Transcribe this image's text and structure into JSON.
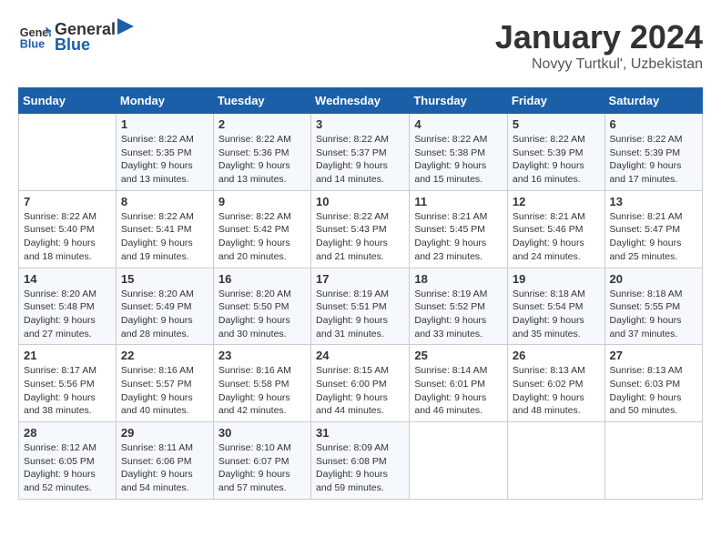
{
  "logo": {
    "line1": "General",
    "line2": "Blue"
  },
  "title": "January 2024",
  "subtitle": "Novyy Turtkul', Uzbekistan",
  "days_of_week": [
    "Sunday",
    "Monday",
    "Tuesday",
    "Wednesday",
    "Thursday",
    "Friday",
    "Saturday"
  ],
  "weeks": [
    [
      {
        "day": "",
        "detail": ""
      },
      {
        "day": "1",
        "detail": "Sunrise: 8:22 AM\nSunset: 5:35 PM\nDaylight: 9 hours\nand 13 minutes."
      },
      {
        "day": "2",
        "detail": "Sunrise: 8:22 AM\nSunset: 5:36 PM\nDaylight: 9 hours\nand 13 minutes."
      },
      {
        "day": "3",
        "detail": "Sunrise: 8:22 AM\nSunset: 5:37 PM\nDaylight: 9 hours\nand 14 minutes."
      },
      {
        "day": "4",
        "detail": "Sunrise: 8:22 AM\nSunset: 5:38 PM\nDaylight: 9 hours\nand 15 minutes."
      },
      {
        "day": "5",
        "detail": "Sunrise: 8:22 AM\nSunset: 5:39 PM\nDaylight: 9 hours\nand 16 minutes."
      },
      {
        "day": "6",
        "detail": "Sunrise: 8:22 AM\nSunset: 5:39 PM\nDaylight: 9 hours\nand 17 minutes."
      }
    ],
    [
      {
        "day": "7",
        "detail": "Sunrise: 8:22 AM\nSunset: 5:40 PM\nDaylight: 9 hours\nand 18 minutes."
      },
      {
        "day": "8",
        "detail": "Sunrise: 8:22 AM\nSunset: 5:41 PM\nDaylight: 9 hours\nand 19 minutes."
      },
      {
        "day": "9",
        "detail": "Sunrise: 8:22 AM\nSunset: 5:42 PM\nDaylight: 9 hours\nand 20 minutes."
      },
      {
        "day": "10",
        "detail": "Sunrise: 8:22 AM\nSunset: 5:43 PM\nDaylight: 9 hours\nand 21 minutes."
      },
      {
        "day": "11",
        "detail": "Sunrise: 8:21 AM\nSunset: 5:45 PM\nDaylight: 9 hours\nand 23 minutes."
      },
      {
        "day": "12",
        "detail": "Sunrise: 8:21 AM\nSunset: 5:46 PM\nDaylight: 9 hours\nand 24 minutes."
      },
      {
        "day": "13",
        "detail": "Sunrise: 8:21 AM\nSunset: 5:47 PM\nDaylight: 9 hours\nand 25 minutes."
      }
    ],
    [
      {
        "day": "14",
        "detail": "Sunrise: 8:20 AM\nSunset: 5:48 PM\nDaylight: 9 hours\nand 27 minutes."
      },
      {
        "day": "15",
        "detail": "Sunrise: 8:20 AM\nSunset: 5:49 PM\nDaylight: 9 hours\nand 28 minutes."
      },
      {
        "day": "16",
        "detail": "Sunrise: 8:20 AM\nSunset: 5:50 PM\nDaylight: 9 hours\nand 30 minutes."
      },
      {
        "day": "17",
        "detail": "Sunrise: 8:19 AM\nSunset: 5:51 PM\nDaylight: 9 hours\nand 31 minutes."
      },
      {
        "day": "18",
        "detail": "Sunrise: 8:19 AM\nSunset: 5:52 PM\nDaylight: 9 hours\nand 33 minutes."
      },
      {
        "day": "19",
        "detail": "Sunrise: 8:18 AM\nSunset: 5:54 PM\nDaylight: 9 hours\nand 35 minutes."
      },
      {
        "day": "20",
        "detail": "Sunrise: 8:18 AM\nSunset: 5:55 PM\nDaylight: 9 hours\nand 37 minutes."
      }
    ],
    [
      {
        "day": "21",
        "detail": "Sunrise: 8:17 AM\nSunset: 5:56 PM\nDaylight: 9 hours\nand 38 minutes."
      },
      {
        "day": "22",
        "detail": "Sunrise: 8:16 AM\nSunset: 5:57 PM\nDaylight: 9 hours\nand 40 minutes."
      },
      {
        "day": "23",
        "detail": "Sunrise: 8:16 AM\nSunset: 5:58 PM\nDaylight: 9 hours\nand 42 minutes."
      },
      {
        "day": "24",
        "detail": "Sunrise: 8:15 AM\nSunset: 6:00 PM\nDaylight: 9 hours\nand 44 minutes."
      },
      {
        "day": "25",
        "detail": "Sunrise: 8:14 AM\nSunset: 6:01 PM\nDaylight: 9 hours\nand 46 minutes."
      },
      {
        "day": "26",
        "detail": "Sunrise: 8:13 AM\nSunset: 6:02 PM\nDaylight: 9 hours\nand 48 minutes."
      },
      {
        "day": "27",
        "detail": "Sunrise: 8:13 AM\nSunset: 6:03 PM\nDaylight: 9 hours\nand 50 minutes."
      }
    ],
    [
      {
        "day": "28",
        "detail": "Sunrise: 8:12 AM\nSunset: 6:05 PM\nDaylight: 9 hours\nand 52 minutes."
      },
      {
        "day": "29",
        "detail": "Sunrise: 8:11 AM\nSunset: 6:06 PM\nDaylight: 9 hours\nand 54 minutes."
      },
      {
        "day": "30",
        "detail": "Sunrise: 8:10 AM\nSunset: 6:07 PM\nDaylight: 9 hours\nand 57 minutes."
      },
      {
        "day": "31",
        "detail": "Sunrise: 8:09 AM\nSunset: 6:08 PM\nDaylight: 9 hours\nand 59 minutes."
      },
      {
        "day": "",
        "detail": ""
      },
      {
        "day": "",
        "detail": ""
      },
      {
        "day": "",
        "detail": ""
      }
    ]
  ]
}
